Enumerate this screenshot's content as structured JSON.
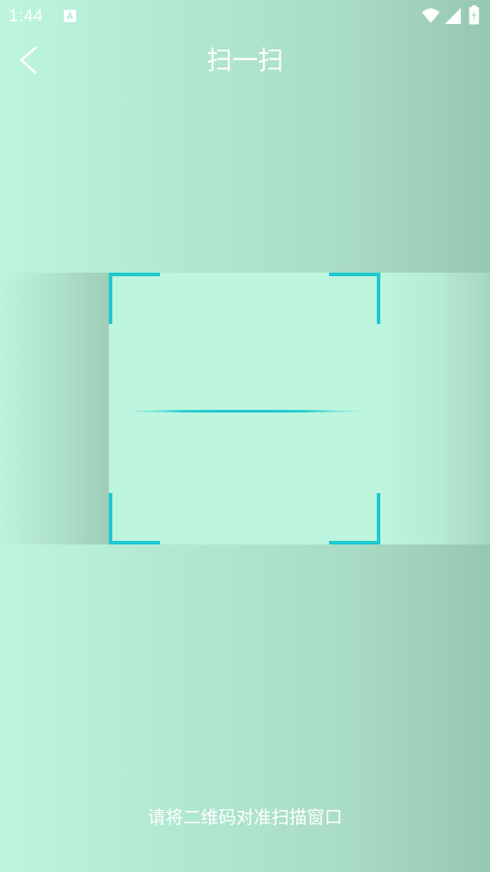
{
  "status_bar": {
    "time": "1:44",
    "icons": [
      "notification-a-icon",
      "wifi-icon",
      "signal-icon",
      "battery-charging-icon"
    ]
  },
  "toolbar": {
    "back_icon": "chevron-left-icon",
    "title": "扫一扫"
  },
  "scanner": {
    "frame_color": "#1dc8cf",
    "hint": "请将二维码对准扫描窗口"
  },
  "colors": {
    "background_start": "#bdf5dd",
    "background_end": "#98c7b1",
    "accent": "#1dc8cf",
    "text": "#ffffff"
  }
}
